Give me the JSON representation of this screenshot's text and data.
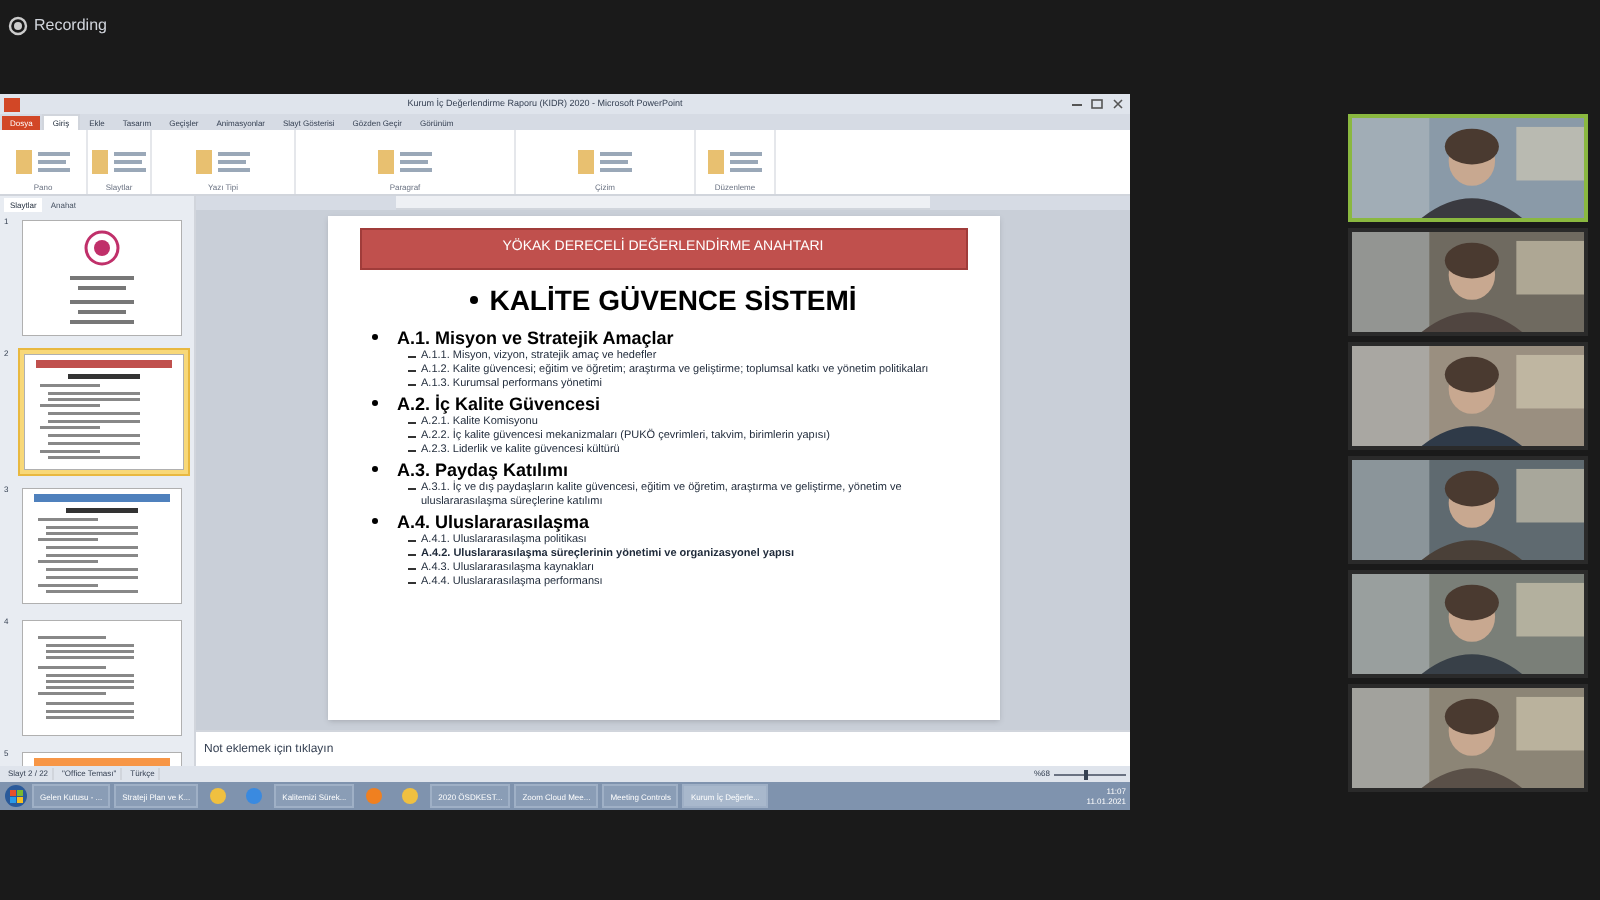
{
  "recording": {
    "label": "Recording"
  },
  "window": {
    "title": "Kurum İç Değerlendirme Raporu (KIDR) 2020 - Microsoft PowerPoint"
  },
  "ribbon": {
    "tabs": [
      {
        "label": "Dosya",
        "kind": "file"
      },
      {
        "label": "Giriş",
        "selected": true,
        "kind": "tab"
      },
      {
        "label": "Ekle",
        "selected": false,
        "kind": "tab"
      },
      {
        "label": "Tasarım",
        "selected": false,
        "kind": "tab"
      },
      {
        "label": "Geçişler",
        "selected": false,
        "kind": "tab"
      },
      {
        "label": "Animasyonlar",
        "selected": false,
        "kind": "tab"
      },
      {
        "label": "Slayt Gösterisi",
        "selected": false,
        "kind": "tab"
      },
      {
        "label": "Gözden Geçir",
        "selected": false,
        "kind": "tab"
      },
      {
        "label": "Görünüm",
        "selected": false,
        "kind": "tab"
      }
    ],
    "groups": [
      "Pano",
      "Slaytlar",
      "Yazı Tipi",
      "Paragraf",
      "Çizim",
      "Düzenleme"
    ]
  },
  "slide_panel": {
    "tabs": [
      {
        "label": "Slaytlar",
        "selected": true
      },
      {
        "label": "Anahat",
        "selected": false
      }
    ],
    "slides": [
      {
        "number": "1",
        "selected": false,
        "kind": "cover"
      },
      {
        "number": "2",
        "selected": true,
        "kind": "content",
        "color": "#c0504d"
      },
      {
        "number": "3",
        "selected": false,
        "kind": "content",
        "color": "#4f81bd"
      },
      {
        "number": "4",
        "selected": false,
        "kind": "plain"
      },
      {
        "number": "5",
        "selected": false,
        "kind": "content",
        "color": "#f79646"
      }
    ]
  },
  "slide": {
    "header": "YÖKAK DERECELİ DEĞERLENDİRME ANAHTARI",
    "title": "KALİTE GÜVENCE SİSTEMİ",
    "sections": [
      {
        "heading": "A.1. Misyon ve Stratejik Amaçlar",
        "items": [
          {
            "text": "A.1.1. Misyon, vizyon, stratejik amaç ve hedefler",
            "bold": false
          },
          {
            "text": "A.1.2. Kalite güvencesi; eğitim ve öğretim; araştırma ve geliştirme; toplumsal katkı ve yönetim politikaları",
            "bold": false
          },
          {
            "text": "A.1.3. Kurumsal performans yönetimi",
            "bold": false
          }
        ]
      },
      {
        "heading": "A.2. İç Kalite Güvencesi",
        "items": [
          {
            "text": "A.2.1. Kalite Komisyonu",
            "bold": false
          },
          {
            "text": "A.2.2. İç kalite güvencesi mekanizmaları (PUKÖ çevrimleri, takvim, birimlerin yapısı)",
            "bold": false
          },
          {
            "text": "A.2.3. Liderlik ve kalite güvencesi kültürü",
            "bold": false
          }
        ]
      },
      {
        "heading": "A.3. Paydaş Katılımı",
        "items": [
          {
            "text": "A.3.1. İç ve dış paydaşların kalite güvencesi, eğitim ve öğretim, araştırma ve geliştirme, yönetim ve uluslararasılaşma süreçlerine katılımı",
            "bold": false
          }
        ]
      },
      {
        "heading": "A.4. Uluslararasılaşma",
        "items": [
          {
            "text": "A.4.1. Uluslararasılaşma politikası",
            "bold": false
          },
          {
            "text": "A.4.2. Uluslararasılaşma süreçlerinin yönetimi ve organizasyonel yapısı",
            "bold": true
          },
          {
            "text": "A.4.3. Uluslararasılaşma kaynakları",
            "bold": false
          },
          {
            "text": "A.4.4. Uluslararasılaşma performansı",
            "bold": false
          }
        ]
      }
    ]
  },
  "notes": {
    "placeholder": "Not eklemek için tıklayın"
  },
  "status_bar": {
    "items": [
      "Slayt 2 / 22",
      "\"Office Teması\"",
      "Türkçe"
    ],
    "zoom": "%68",
    "zoom_slider": {
      "level": 0.45
    }
  },
  "taskbar": {
    "items": [
      {
        "label": "Gelen Kutusu - ...",
        "selected": false
      },
      {
        "label": "Strateji Plan ve K...",
        "selected": false
      },
      {
        "selected": false,
        "kind": "icon"
      },
      {
        "selected": false,
        "kind": "icon"
      },
      {
        "label": "Kalitemizi Sürek...",
        "selected": false
      },
      {
        "selected": false,
        "kind": "icon"
      },
      {
        "selected": false,
        "kind": "icon"
      },
      {
        "label": "2020 ÖSDKEST...",
        "selected": false
      },
      {
        "label": "Zoom Cloud Mee...",
        "selected": false
      },
      {
        "label": "Meeting Controls",
        "selected": false
      },
      {
        "label": "Kurum İç Değerle...",
        "selected": true
      }
    ],
    "time": "11:07",
    "date": "11.01.2021"
  },
  "participants": [
    {
      "speaking": true
    },
    {
      "speaking": false
    },
    {
      "speaking": false
    },
    {
      "speaking": false
    },
    {
      "speaking": false
    },
    {
      "speaking": false
    }
  ]
}
